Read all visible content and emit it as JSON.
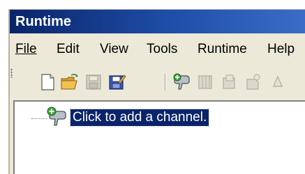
{
  "window": {
    "title": "Runtime"
  },
  "menu": {
    "items": [
      {
        "label": "File"
      },
      {
        "label": "Edit"
      },
      {
        "label": "View"
      },
      {
        "label": "Tools"
      },
      {
        "label": "Runtime"
      },
      {
        "label": "Help"
      }
    ]
  },
  "toolbar": {
    "buttons": [
      {
        "icon": "new-document-icon",
        "enabled": true
      },
      {
        "icon": "open-folder-icon",
        "enabled": true
      },
      {
        "icon": "save-icon",
        "enabled": false
      },
      {
        "icon": "save-as-icon",
        "enabled": true
      },
      {
        "icon": "add-channel-icon",
        "enabled": true
      },
      {
        "icon": "add-block-icon",
        "enabled": false
      },
      {
        "icon": "add-item-icon",
        "enabled": false
      },
      {
        "icon": "add-element-icon",
        "enabled": false
      },
      {
        "icon": "more-icon",
        "enabled": false
      }
    ]
  },
  "tree": {
    "add_channel_label": "Click to add a channel."
  },
  "colors": {
    "title_bar": "#0a246a",
    "selection": "#0a246a",
    "face": "#ece9d8"
  }
}
